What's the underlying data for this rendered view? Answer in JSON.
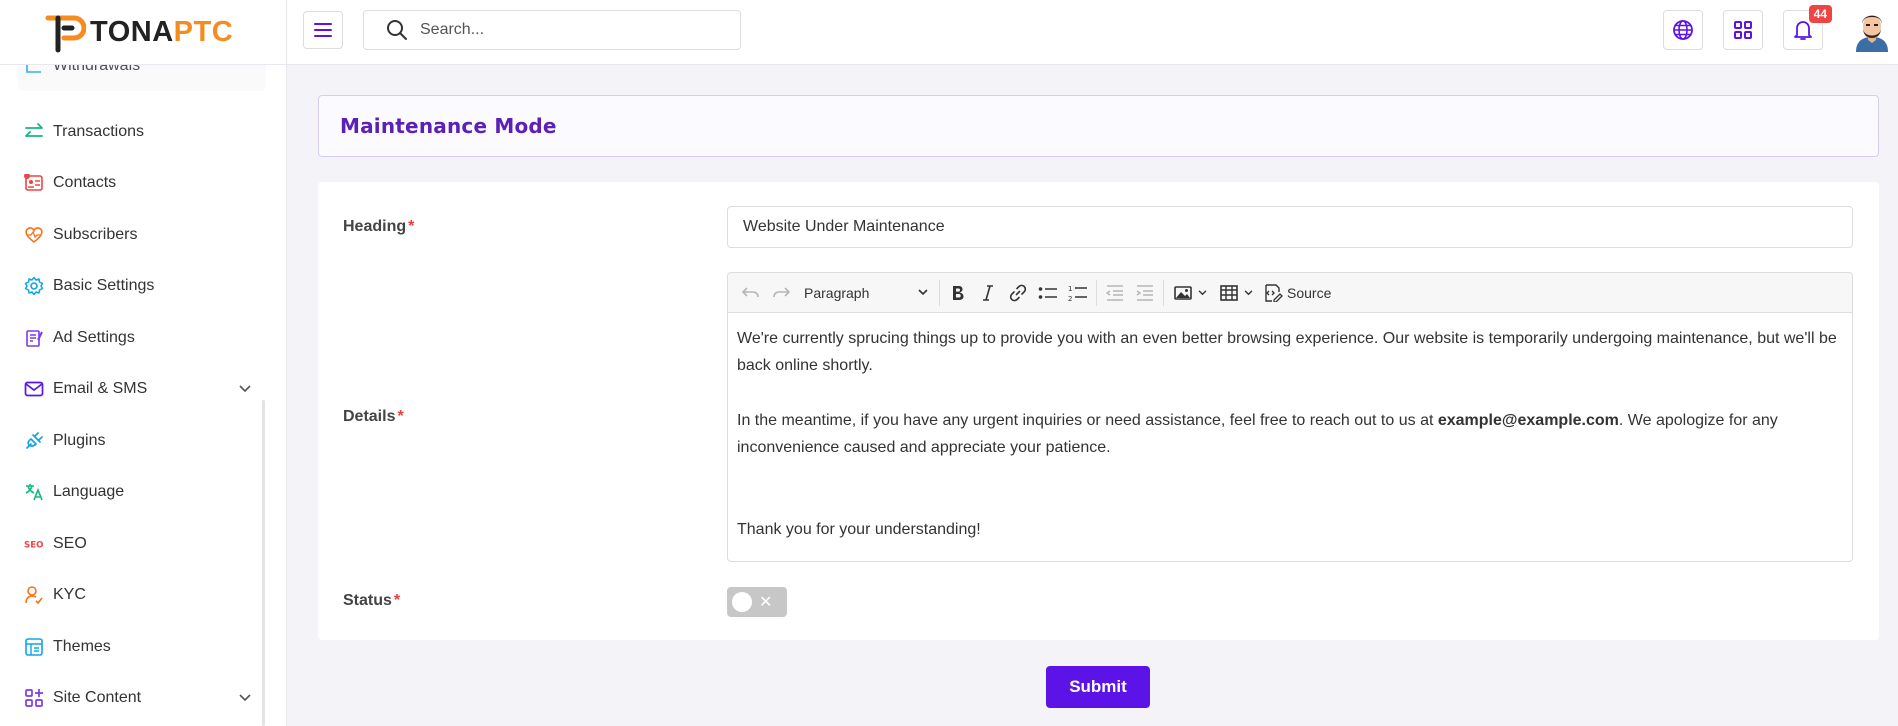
{
  "brand": {
    "part1": "TONA",
    "part2": "PTC"
  },
  "search": {
    "placeholder": "Search..."
  },
  "notifications": {
    "count": "44"
  },
  "sidebar": {
    "items": [
      {
        "label": "Withdrawals"
      },
      {
        "label": "Transactions"
      },
      {
        "label": "Contacts"
      },
      {
        "label": "Subscribers"
      },
      {
        "label": "Basic Settings"
      },
      {
        "label": "Ad Settings"
      },
      {
        "label": "Email & SMS"
      },
      {
        "label": "Plugins"
      },
      {
        "label": "Language"
      },
      {
        "label": "SEO"
      },
      {
        "label": "KYC"
      },
      {
        "label": "Themes"
      },
      {
        "label": "Site Content"
      }
    ]
  },
  "page": {
    "title": "Maintenance Mode"
  },
  "form": {
    "heading_label": "Heading",
    "heading_value": "Website Under Maintenance",
    "details_label": "Details",
    "status_label": "Status",
    "required_mark": "*",
    "submit_label": "Submit"
  },
  "editor": {
    "paragraph_select": "Paragraph",
    "source_label": "Source",
    "p1": "We're currently sprucing things up to provide you with an even better browsing experience. Our website is temporarily undergoing maintenance, but we'll be back online shortly.",
    "p2_before": "In the meantime, if you have any urgent inquiries or need assistance, feel free to reach out to us at ",
    "p2_email": "example@example.com",
    "p2_after": ". We apologize for any inconvenience caused and appreciate your patience.",
    "p3": "Thank you for your understanding!"
  },
  "colors": {
    "accent": "#5b13e7",
    "brand_orange": "#f68b1f",
    "title_purple": "#5b21b6",
    "required": "#e53e3e"
  }
}
